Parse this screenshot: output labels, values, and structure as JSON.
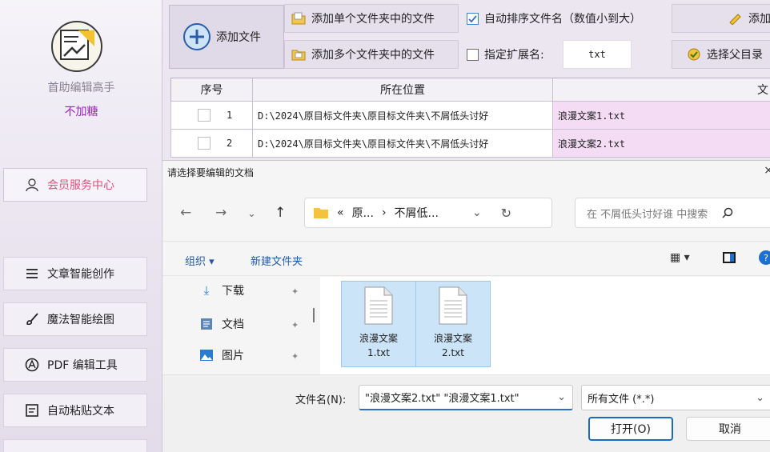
{
  "sidebar": {
    "app_name": "首助编辑高手",
    "app_sub": "不加糖",
    "member_center": "会员服务中心",
    "nav_items": [
      {
        "label": "文章智能创作",
        "icon": "list-icon"
      },
      {
        "label": "魔法智能绘图",
        "icon": "brush-icon"
      },
      {
        "label": "PDF 编辑工具",
        "icon": "pdf-icon"
      },
      {
        "label": "自动粘贴文本",
        "icon": "paste-icon"
      }
    ]
  },
  "toolbar": {
    "add_file": "添加文件",
    "add_single_folder": "添加单个文件夹中的文件",
    "add_multi_folders": "添加多个文件夹中的文件",
    "auto_sort": "自动排序文件名（数值小到大）",
    "auto_sort_checked": true,
    "specify_ext": "指定扩展名:",
    "specify_ext_checked": false,
    "ext_value": "txt",
    "add_more": "添加多",
    "choose_parent": "选择父目录"
  },
  "table": {
    "headers": {
      "index": "序号",
      "location": "所在位置",
      "file": "文"
    },
    "rows": [
      {
        "index": "1",
        "location": "D:\\2024\\原目标文件夹\\原目标文件夹\\不屑低头讨好",
        "file": "浪漫文案1.txt"
      },
      {
        "index": "2",
        "location": "D:\\2024\\原目标文件夹\\原目标文件夹\\不屑低头讨好",
        "file": "浪漫文案2.txt"
      }
    ]
  },
  "dialog": {
    "title": "请选择要编辑的文档",
    "close": "×",
    "breadcrumb": {
      "prefix": "«",
      "seg1": "原...",
      "sep": "›",
      "seg2": "不屑低..."
    },
    "search_placeholder": "在 不屑低头讨好谁 中搜索",
    "organize": "组织 ▾",
    "new_folder": "新建文件夹",
    "quick_access": [
      {
        "label": "下载",
        "icon": "download-icon"
      },
      {
        "label": "文档",
        "icon": "document-icon"
      },
      {
        "label": "图片",
        "icon": "picture-icon"
      }
    ],
    "files": [
      {
        "name_line1": "浪漫文案",
        "name_line2": "1.txt"
      },
      {
        "name_line1": "浪漫文案",
        "name_line2": "2.txt"
      }
    ],
    "filename_label": "文件名(N):",
    "filename_value": "\"浪漫文案2.txt\" \"浪漫文案1.txt\"",
    "filetype_value": "所有文件 (*.*)",
    "open_button": "打开(O)",
    "cancel_button": "取消"
  },
  "colors": {
    "accent": "#1a6bc4",
    "member": "#e0507a",
    "app_sub": "#a020c8",
    "selected_tile": "#cce4f7"
  }
}
